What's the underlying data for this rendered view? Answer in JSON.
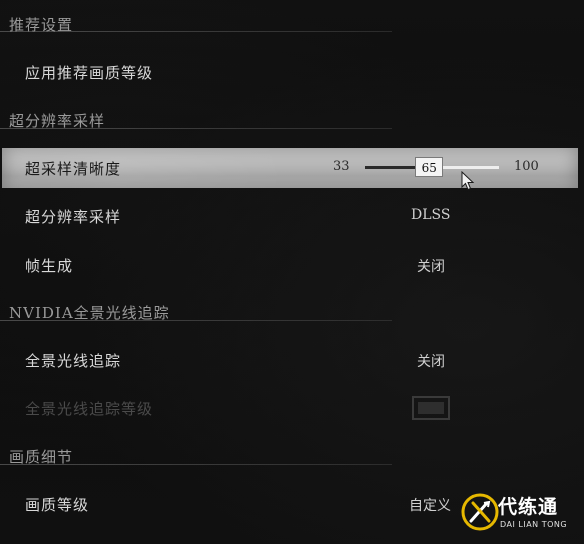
{
  "sections": {
    "recommend": {
      "title": "推荐设置"
    },
    "upscale": {
      "title": "超分辨率采样"
    },
    "raytracing": {
      "title": "NVIDIA全景光线追踪"
    },
    "quality": {
      "title": "画质细节"
    }
  },
  "rows": {
    "apply_recommended": {
      "label": "应用推荐画质等级"
    },
    "supersampling_sharpness": {
      "label": "超采样清晰度",
      "slider": {
        "min": "33",
        "max": "100",
        "value": "65",
        "fraction": 0.48
      }
    },
    "upscaling": {
      "label": "超分辨率采样",
      "value": "DLSS"
    },
    "frame_gen": {
      "label": "帧生成",
      "value": "关闭"
    },
    "full_raytracing": {
      "label": "全景光线追踪",
      "value": "关闭"
    },
    "raytracing_level": {
      "label": "全景光线追踪等级"
    },
    "quality_level": {
      "label": "画质等级",
      "value": "自定义"
    }
  },
  "watermark": {
    "brand": "代练通",
    "sub": "DAI LIAN TONG",
    "icon": "swords-logo-icon"
  },
  "colors": {
    "highlight": "#c4c4c4",
    "background": "#0d0d0d",
    "accent": "#e6b800"
  }
}
